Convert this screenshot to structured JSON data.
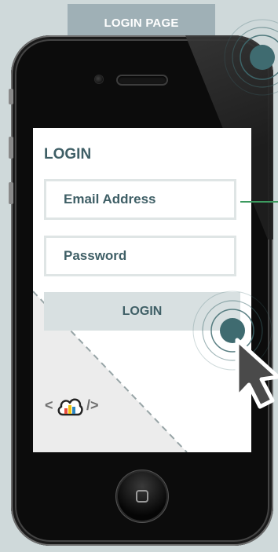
{
  "banner": {
    "label": "LOGIN PAGE"
  },
  "screen": {
    "title": "LOGIN",
    "email": {
      "placeholder": "Email Address"
    },
    "password": {
      "placeholder": "Password"
    },
    "login_button": {
      "label": "LOGIN"
    }
  },
  "logo": {
    "left_code": "<",
    "right_code": "/>",
    "icon": "cloud-bar-chart-icon"
  },
  "colors": {
    "accent": "#3f6b70",
    "text": "#3f5f66",
    "banner": "#9fb0b6",
    "field_border": "#dfe5e5",
    "button_bg": "#d8e0e1",
    "connector": "#3c9a5f"
  }
}
